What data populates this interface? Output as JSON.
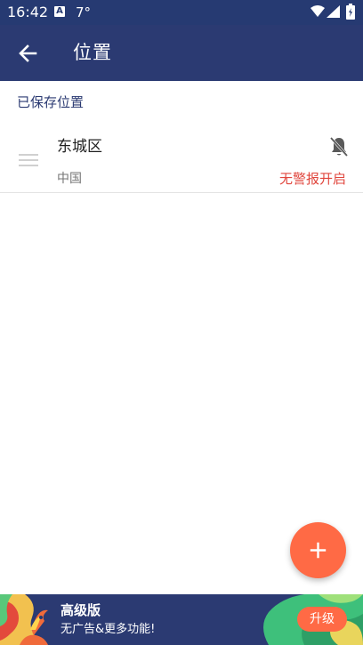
{
  "status_bar": {
    "time": "16:42",
    "notification_badge": "A",
    "temperature": "7°",
    "icons": [
      "wifi-icon",
      "signal-icon",
      "battery-icon"
    ]
  },
  "app_bar": {
    "back_icon": "arrow-left-icon",
    "title": "位置"
  },
  "section": {
    "header": "已保存位置"
  },
  "locations": [
    {
      "name": "东城区",
      "country": "中国",
      "alert_icon": "bell-off-icon",
      "alert_status": "无警报开启"
    }
  ],
  "fab": {
    "icon": "plus-icon"
  },
  "premium_banner": {
    "title": "高级版",
    "subtitle": "无广告&更多功能!",
    "upgrade_label": "升级"
  },
  "colors": {
    "primary": "#2b3a72",
    "accent": "#ff6a45",
    "alert_text": "#e0463d",
    "background": "#ffffff"
  }
}
